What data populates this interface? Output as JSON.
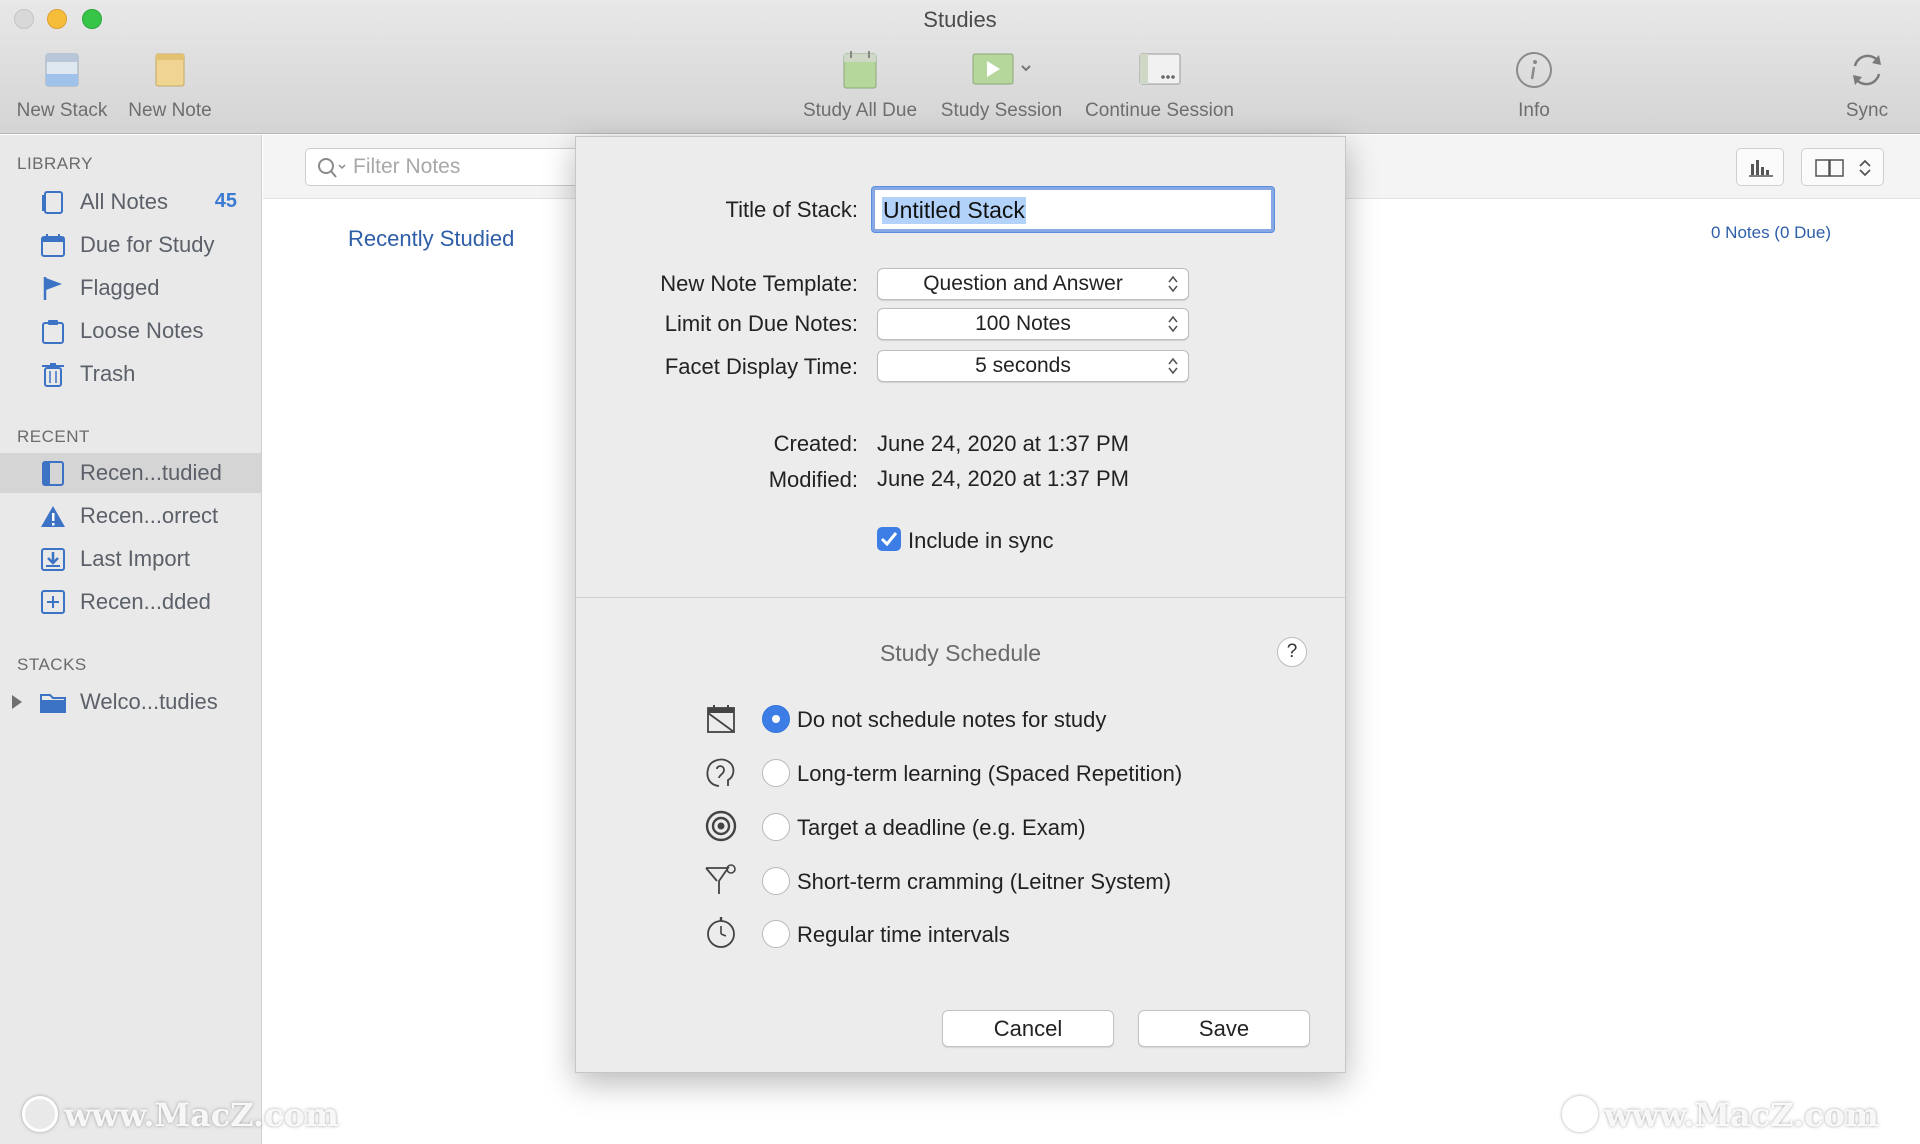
{
  "window": {
    "title": "Studies"
  },
  "toolbar": {
    "new_stack": "New Stack",
    "new_note": "New Note",
    "study_all_due": "Study All Due",
    "study_session": "Study Session",
    "continue_session": "Continue Session",
    "info": "Info",
    "sync": "Sync"
  },
  "sidebar": {
    "library_header": "LIBRARY",
    "library": [
      {
        "label": "All Notes",
        "count": "45",
        "icon": "notes-icon"
      },
      {
        "label": "Due for Study",
        "icon": "calendar-icon"
      },
      {
        "label": "Flagged",
        "icon": "flag-icon"
      },
      {
        "label": "Loose Notes",
        "icon": "clipboard-icon"
      },
      {
        "label": "Trash",
        "icon": "trash-icon"
      }
    ],
    "recent_header": "RECENT",
    "recent": [
      {
        "label": "Recen...tudied",
        "icon": "book-icon",
        "selected": true
      },
      {
        "label": "Recen...orrect",
        "icon": "warning-icon"
      },
      {
        "label": "Last Import",
        "icon": "import-icon"
      },
      {
        "label": "Recen...dded",
        "icon": "plus-box-icon"
      }
    ],
    "stacks_header": "STACKS",
    "stacks": [
      {
        "label": "Welco...tudies",
        "icon": "folder-icon"
      }
    ]
  },
  "main": {
    "filter_placeholder": "Filter Notes",
    "heading": "Recently Studied",
    "notes_count": "0 Notes (0 Due)"
  },
  "sheet": {
    "title_label": "Title of Stack:",
    "title_value": "Untitled Stack",
    "template_label": "New Note Template:",
    "template_value": "Question and Answer",
    "limit_label": "Limit on Due Notes:",
    "limit_value": "100 Notes",
    "facet_label": "Facet Display Time:",
    "facet_value": "5 seconds",
    "created_label": "Created:",
    "created_value": "June 24, 2020 at 1:37 PM",
    "modified_label": "Modified:",
    "modified_value": "June 24, 2020 at 1:37 PM",
    "sync_label": "Include in sync",
    "sync_checked": true,
    "schedule_title": "Study Schedule",
    "help": "?",
    "schedule_options": [
      {
        "label": "Do not schedule notes for study",
        "icon": "calendar-off-icon",
        "selected": true
      },
      {
        "label": "Long-term learning (Spaced Repetition)",
        "icon": "brain-icon",
        "selected": false
      },
      {
        "label": "Target a deadline (e.g. Exam)",
        "icon": "target-icon",
        "selected": false
      },
      {
        "label": "Short-term cramming (Leitner System)",
        "icon": "funnel-icon",
        "selected": false
      },
      {
        "label": "Regular time intervals",
        "icon": "stopwatch-icon",
        "selected": false
      }
    ],
    "cancel": "Cancel",
    "save": "Save"
  },
  "watermark": "www.MacZ.com",
  "colors": {
    "accent": "#3c7ee6",
    "link": "#2e5ea7",
    "sidebar_bg": "#e9e9e9",
    "sheet_bg": "#ececec"
  }
}
